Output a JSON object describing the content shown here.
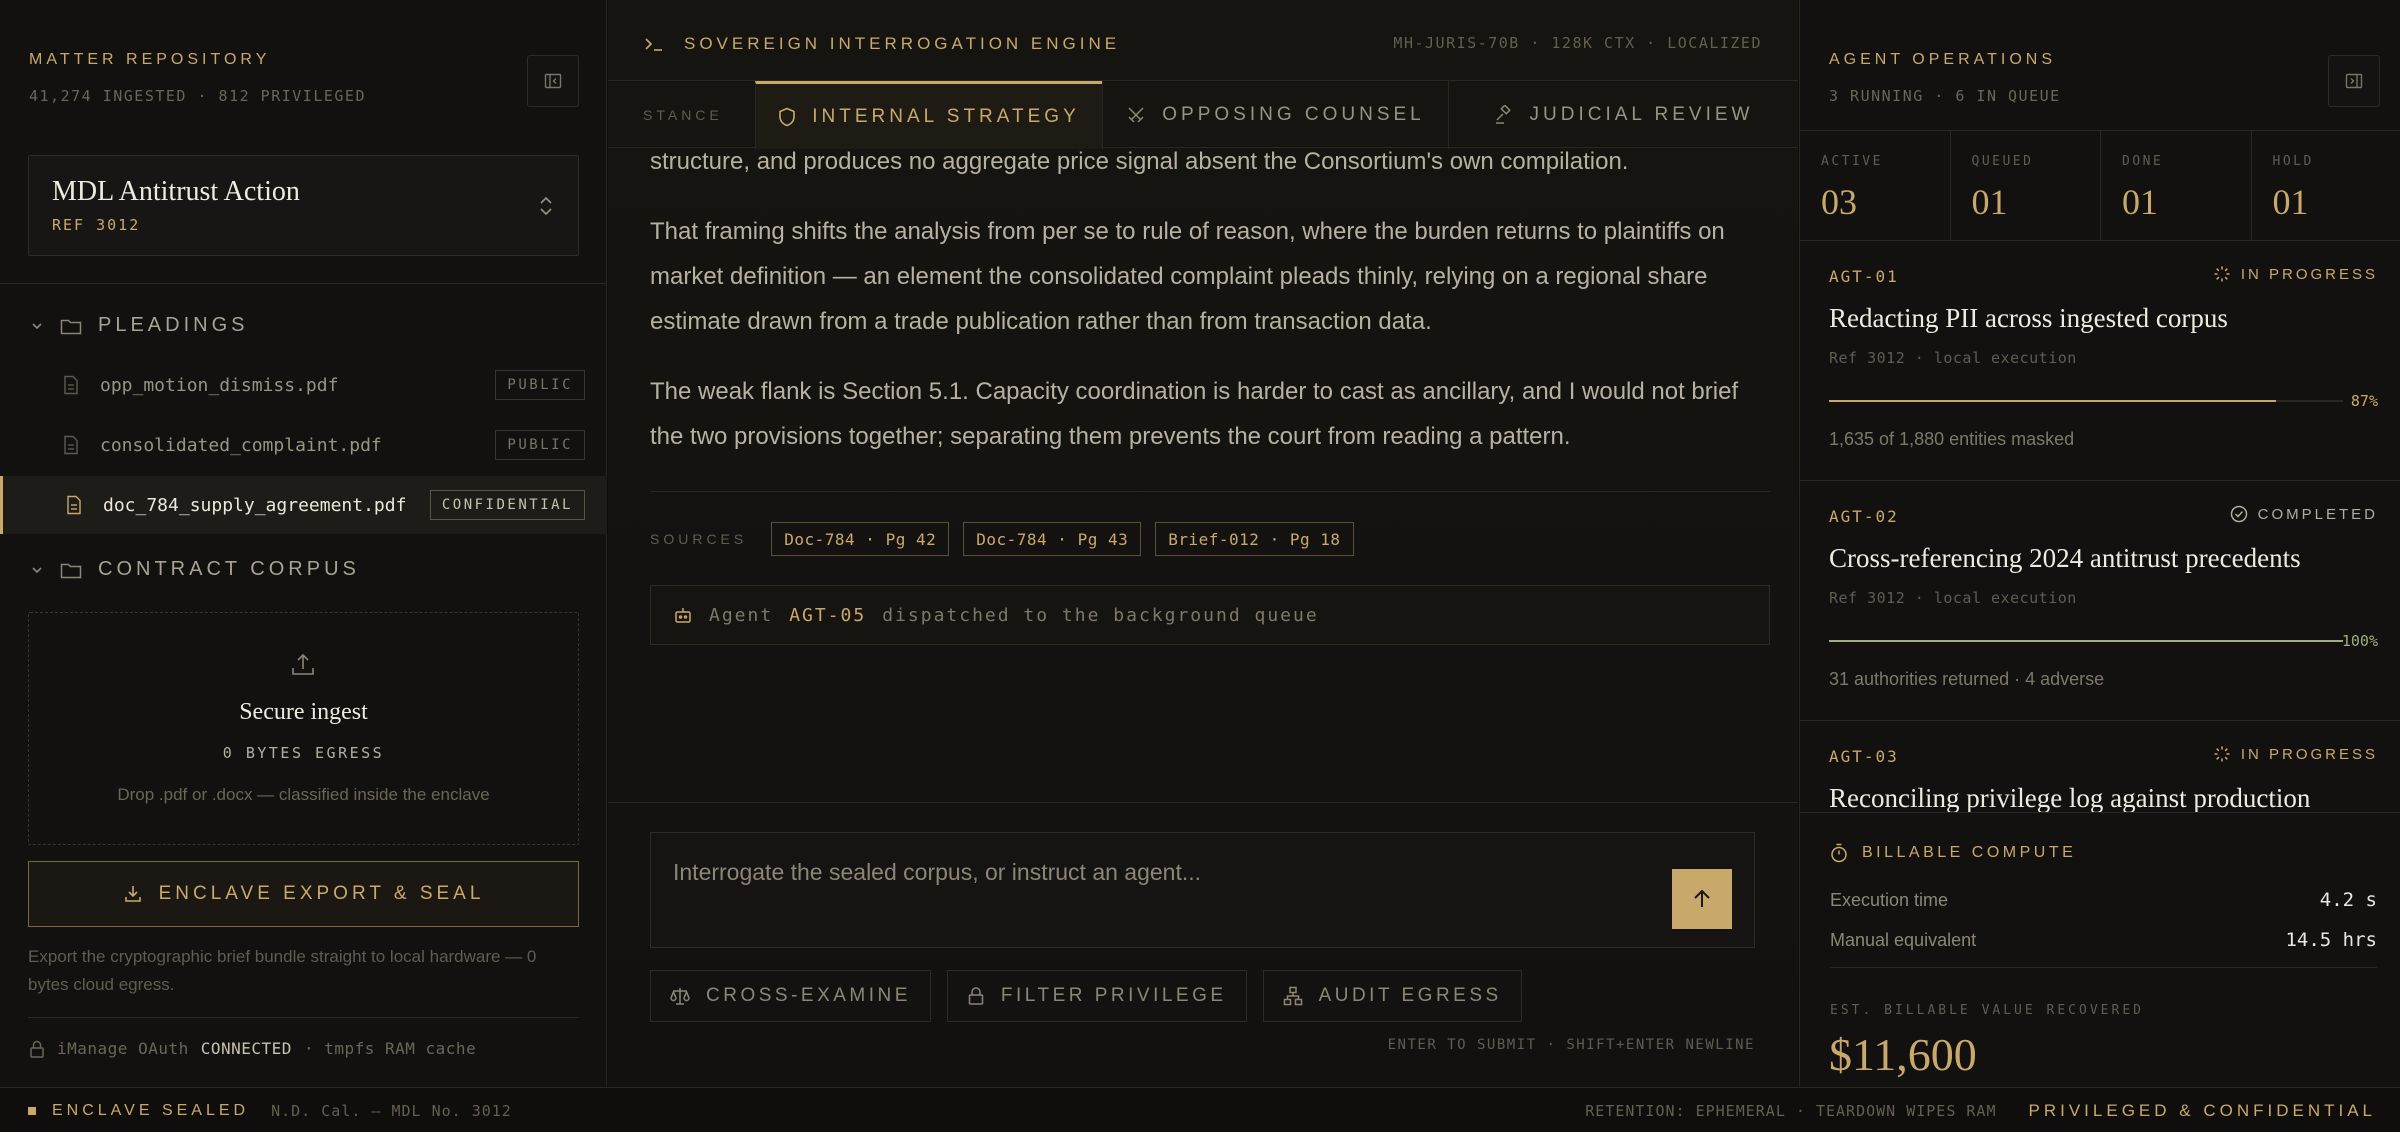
{
  "sidebar": {
    "title": "MATTER REPOSITORY",
    "subtitle": "41,274 INGESTED · 812 PRIVILEGED",
    "collapse_icon": "panel-left-collapse-icon",
    "matter": {
      "name": "MDL Antitrust Action",
      "ref": "REF 3012"
    },
    "folders": [
      {
        "label": "PLEADINGS",
        "expanded": true,
        "files": [
          {
            "name": "opp_motion_dismiss.pdf",
            "badge": "PUBLIC"
          },
          {
            "name": "consolidated_complaint.pdf",
            "badge": "PUBLIC"
          },
          {
            "name": "doc_784_supply_agreement.pdf",
            "badge": "CONFIDENTIAL",
            "active": true
          }
        ]
      },
      {
        "label": "CONTRACT CORPUS",
        "expanded": true,
        "files": []
      }
    ],
    "ingest": {
      "title": "Secure ingest",
      "egress": "0 BYTES EGRESS",
      "hint": "Drop .pdf or .docx — classified inside the enclave"
    },
    "export_label": "ENCLAVE EXPORT & SEAL",
    "export_note": "Export the cryptographic brief bundle straight to local hardware — 0 bytes cloud egress.",
    "connection": {
      "prefix": "iManage OAuth",
      "status": "CONNECTED",
      "suffix": "· tmpfs RAM cache"
    }
  },
  "center": {
    "engine_title": "SOVEREIGN INTERROGATION ENGINE",
    "model_info": "MH-JURIS-70B · 128K CTX · LOCALIZED",
    "stance_label": "STANCE",
    "tabs": [
      {
        "label": "INTERNAL STRATEGY",
        "icon": "shield-icon",
        "active": true
      },
      {
        "label": "OPPOSING COUNSEL",
        "icon": "crossed-swords-icon",
        "active": false
      },
      {
        "label": "JUDICIAL REVIEW",
        "icon": "gavel-icon",
        "active": false
      }
    ],
    "paragraphs": [
      "structure, and produces no aggregate price signal absent the Consortium's own compilation.",
      "That framing shifts the analysis from per se to rule of reason, where the burden returns to plaintiffs on market definition — an element the consolidated complaint pleads thinly, relying on a regional share estimate drawn from a trade publication rather than from transaction data.",
      "The weak flank is Section 5.1. Capacity coordination is harder to cast as ancillary, and I would not brief the two provisions together; separating them prevents the court from reading a pattern."
    ],
    "sources_label": "SOURCES",
    "sources": [
      "Doc-784 · Pg 42",
      "Doc-784 · Pg 43",
      "Brief-012 · Pg 18"
    ],
    "dispatch": {
      "prefix": "Agent",
      "agent": "AGT-05",
      "suffix": "dispatched to the background queue"
    },
    "composer_placeholder": "Interrogate the sealed corpus, or instruct an agent...",
    "actions": [
      {
        "label": "CROSS-EXAMINE",
        "icon": "scales-icon"
      },
      {
        "label": "FILTER PRIVILEGE",
        "icon": "lock-icon"
      },
      {
        "label": "AUDIT EGRESS",
        "icon": "network-icon"
      }
    ],
    "hint": "ENTER TO SUBMIT · SHIFT+ENTER NEWLINE"
  },
  "agents_panel": {
    "title": "AGENT OPERATIONS",
    "subtitle": "3 RUNNING · 6 IN QUEUE",
    "stats": [
      {
        "label": "ACTIVE",
        "value": "03"
      },
      {
        "label": "QUEUED",
        "value": "01"
      },
      {
        "label": "DONE",
        "value": "01"
      },
      {
        "label": "HOLD",
        "value": "01"
      }
    ],
    "agents": [
      {
        "id": "AGT-01",
        "status": "IN PROGRESS",
        "title": "Redacting PII across ingested corpus",
        "ref": "Ref 3012 · local execution",
        "progress": 87,
        "progress_label": "87%",
        "detail": "1,635 of 1,880 entities masked"
      },
      {
        "id": "AGT-02",
        "status": "COMPLETED",
        "title": "Cross-referencing 2024 antitrust precedents",
        "ref": "Ref 3012 · local execution",
        "progress": 100,
        "progress_label": "100%",
        "detail": "31 authorities returned · 4 adverse"
      },
      {
        "id": "AGT-03",
        "status": "IN PROGRESS",
        "title": "Reconciling privilege log against production",
        "ref": "",
        "progress": 0,
        "progress_label": "",
        "detail": ""
      }
    ],
    "billing": {
      "title": "BILLABLE COMPUTE",
      "rows": [
        {
          "label": "Execution time",
          "value": "4.2 s"
        },
        {
          "label": "Manual equivalent",
          "value": "14.5 hrs"
        }
      ],
      "value_label": "EST. BILLABLE VALUE RECOVERED",
      "value": "$11,600"
    }
  },
  "statusbar": {
    "sealed": "ENCLAVE SEALED",
    "case": "N.D. Cal. — MDL No. 3012",
    "retention": "RETENTION: EPHEMERAL · TEARDOWN WIPES RAM",
    "privileged": "PRIVILEGED & CONFIDENTIAL"
  },
  "colors": {
    "accent": "#c9a96b",
    "background": "#0e0d0b",
    "success": "#9fae7c"
  }
}
